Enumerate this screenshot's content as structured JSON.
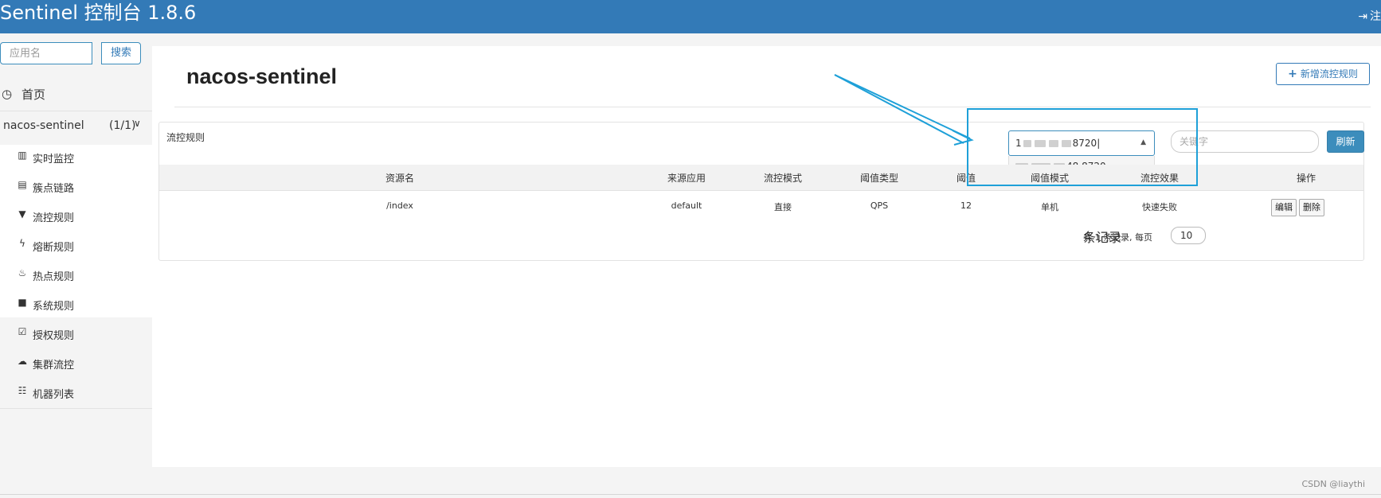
{
  "header": {
    "brand": "Sentinel 控制台 1.8.6",
    "logout_icon": "sign-out-icon",
    "logout_label": "注",
    "color": "#337ab7"
  },
  "sidebar": {
    "search_placeholder": "应用名",
    "search_button": "搜索",
    "home_icon": "dashboard-icon",
    "home_label": "首页",
    "app_name": "nacos-sentinel",
    "app_count": "(1/1)",
    "items": [
      {
        "icon": "bar-chart-icon",
        "label": "实时监控"
      },
      {
        "icon": "list-icon",
        "label": "簇点链路"
      },
      {
        "icon": "filter-icon",
        "label": "流控规则"
      },
      {
        "icon": "bolt-icon",
        "label": "熔断规则"
      },
      {
        "icon": "fire-icon",
        "label": "热点规则"
      },
      {
        "icon": "lock-icon",
        "label": "系统规则"
      },
      {
        "icon": "check-square-icon",
        "label": "授权规则"
      },
      {
        "icon": "cloud-icon",
        "label": "集群流控"
      },
      {
        "icon": "th-list-icon",
        "label": "机器列表"
      }
    ]
  },
  "main": {
    "title": "nacos-sentinel",
    "add_button": "新增流控规则",
    "panel_title": "流控规则",
    "machine_prefix": "1",
    "machine_suffix": "8720",
    "dropdown_option": "48.8720",
    "keyword_placeholder": "关键字",
    "refresh_button": "刷新",
    "columns": [
      "资源名",
      "来源应用",
      "流控模式",
      "阈值类型",
      "阈值",
      "阈值模式",
      "流控效果",
      "操作"
    ],
    "rows": [
      [
        "/index",
        "default",
        "直接",
        "QPS",
        "12",
        "单机",
        "快速失败"
      ]
    ],
    "edit_button": "编辑",
    "delete_button": "删除",
    "pager_prefix": "共 1 条记录, 每页",
    "page_size": "10",
    "pager_suffix": "条记录"
  },
  "annotation": {
    "color": "#1ea0d8"
  },
  "watermark": "CSDN @liaythi"
}
